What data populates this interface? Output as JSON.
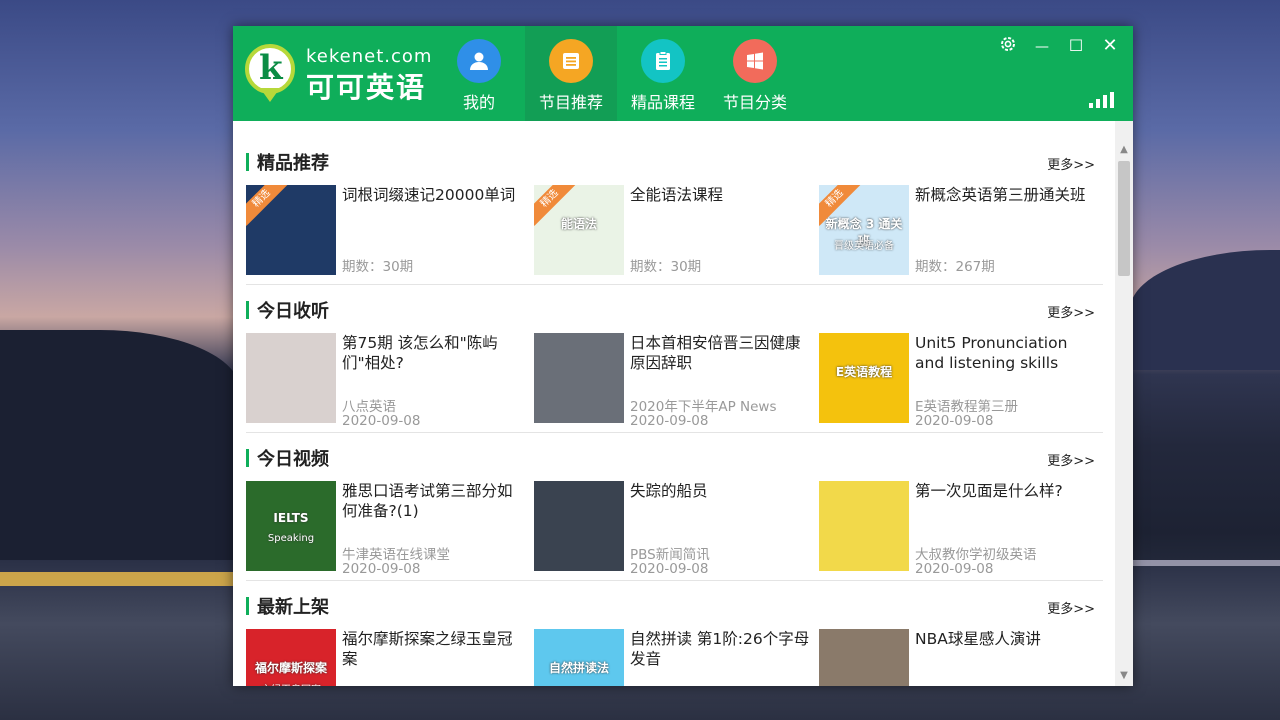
{
  "app": {
    "domain": "kekenet.com",
    "name": "可可英语"
  },
  "nav": [
    {
      "label": "我的",
      "icon": "user-icon",
      "color": "#2f8fe8"
    },
    {
      "label": "节目推荐",
      "icon": "list-icon",
      "color": "#f5a623",
      "active": true
    },
    {
      "label": "精品课程",
      "icon": "clipboard-icon",
      "color": "#13c4c4"
    },
    {
      "label": "节目分类",
      "icon": "windows-grid-icon",
      "color": "#f26b5b"
    }
  ],
  "window_controls": {
    "settings": "⚙",
    "minimize": "—",
    "maximize": "☐",
    "close": "✕"
  },
  "colors": {
    "brand_green": "#0fae5a",
    "badge_orange": "#f08a3a"
  },
  "sections": [
    {
      "title": "精品推荐",
      "more": "更多>>",
      "items": [
        {
          "title": "词根词缀速记20000单词",
          "count": "期数：30期",
          "badge": "精选"
        },
        {
          "title": "全能语法课程",
          "count": "期数：30期",
          "badge": "精选"
        },
        {
          "title": "新概念英语第三册通关班",
          "count": "期数：267期",
          "badge": "精选"
        }
      ]
    },
    {
      "title": "今日收听",
      "more": "更多>>",
      "items": [
        {
          "title": "第75期 该怎么和\"陈屿们\"相处?",
          "source": "八点英语",
          "date": "2020-09-08"
        },
        {
          "title": "日本首相安倍晋三因健康原因辞职",
          "source": "2020年下半年AP News",
          "date": "2020-09-08"
        },
        {
          "title": "Unit5 Pronunciation and listening skills",
          "source": "E英语教程第三册",
          "date": "2020-09-08"
        }
      ]
    },
    {
      "title": "今日视频",
      "more": "更多>>",
      "items": [
        {
          "title": "雅思口语考试第三部分如何准备?(1)",
          "source": "牛津英语在线课堂",
          "date": "2020-09-08"
        },
        {
          "title": "失踪的船员",
          "source": "PBS新闻简讯",
          "date": "2020-09-08"
        },
        {
          "title": "第一次见面是什么样?",
          "source": "大叔教你学初级英语",
          "date": "2020-09-08"
        }
      ]
    },
    {
      "title": "最新上架",
      "more": "更多>>",
      "items": [
        {
          "title": "福尔摩斯探案之绿玉皇冠案",
          "source": "",
          "date": ""
        },
        {
          "title": "自然拼读 第1阶:26个字母发音",
          "source": "",
          "date": ""
        },
        {
          "title": "NBA球星感人演讲",
          "source": "",
          "date": ""
        }
      ]
    }
  ],
  "thumbnails": {
    "s0i0": {
      "bg": "#1f3a66"
    },
    "s0i1": {
      "bg": "#eaf3e6",
      "text": "能语法"
    },
    "s0i2": {
      "bg": "#cfe8f7",
      "text": "新概念 3 通关班",
      "sub": "晋级英语必备"
    },
    "s1i0": {
      "bg": "#d9d1cf"
    },
    "s1i1": {
      "bg": "#6a6f78"
    },
    "s1i2": {
      "bg": "#f4c20d",
      "text": "E英语教程"
    },
    "s2i0": {
      "bg": "#2b6b2b",
      "text": "IELTS",
      "sub": "Speaking"
    },
    "s2i1": {
      "bg": "#3a4350"
    },
    "s2i2": {
      "bg": "#f2d94a"
    },
    "s3i0": {
      "bg": "#d8232a",
      "text": "福尔摩斯探案",
      "sub": "之绿玉皇冠案"
    },
    "s3i1": {
      "bg": "#5ec8ee",
      "text": "自然拼读法"
    },
    "s3i2": {
      "bg": "#8a7a6a"
    }
  }
}
